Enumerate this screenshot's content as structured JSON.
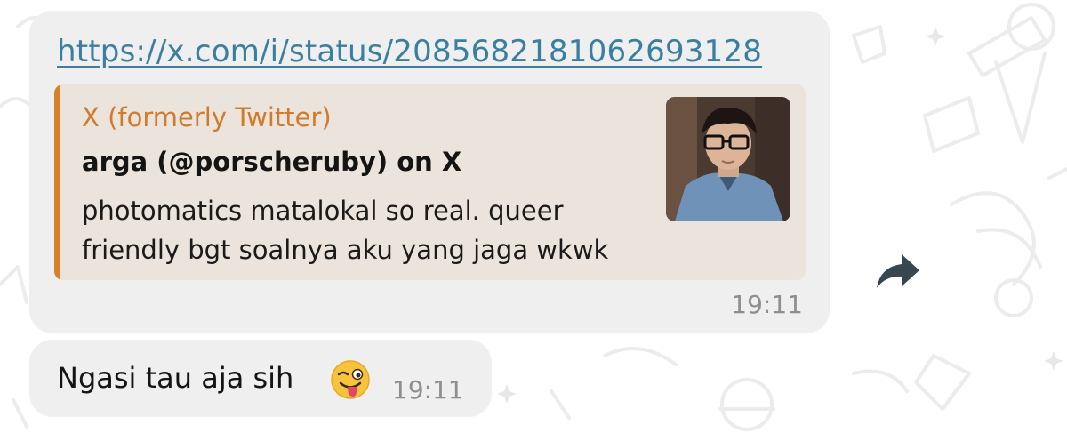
{
  "messages": [
    {
      "link": "https://x.com/i/status/2085682181062693128",
      "preview": {
        "site": "X (formerly Twitter)",
        "title": "arga (@porscheruby) on X",
        "description": "photomatics matalokal so real. queer friendly bgt soalnya aku yang jaga wkwk",
        "thumbnail_icon": "profile-photo"
      },
      "time": "19:11",
      "forward_icon": "forward-arrow-icon"
    },
    {
      "text": "Ngasi tau aja sih",
      "emoji": "winking-face-with-tongue",
      "time": "19:11"
    }
  ],
  "colors": {
    "bubble": "#efefef",
    "preview_bg": "#ebe4dc",
    "accent_bar": "#d9802a",
    "site_name": "#d27a2c",
    "link": "#3b7fa0",
    "timestamp": "#8e8e8e"
  }
}
